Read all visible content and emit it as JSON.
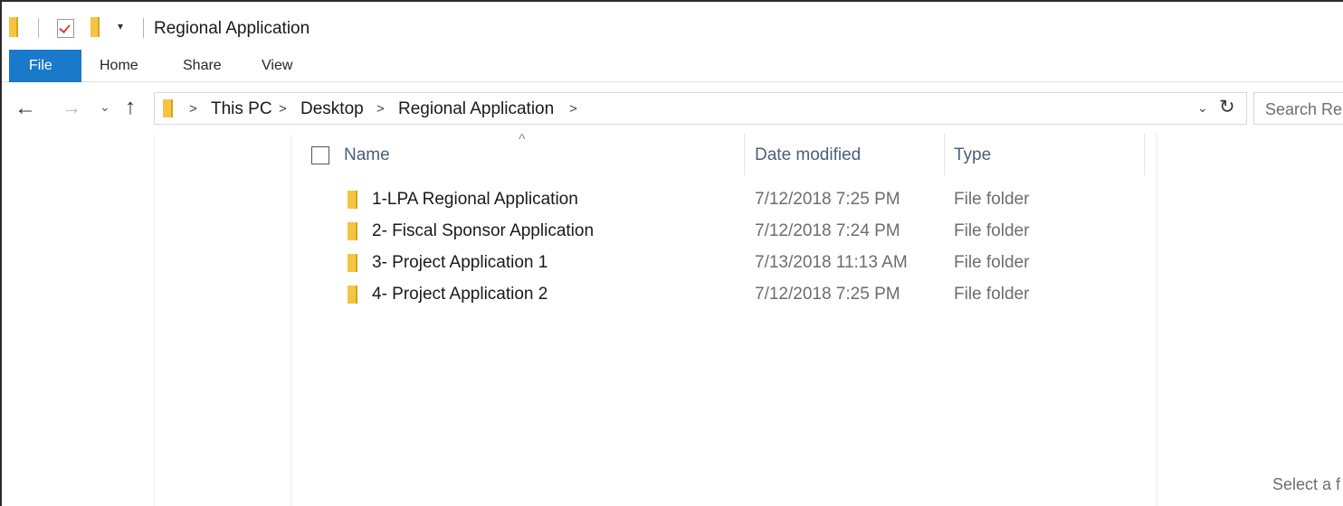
{
  "window": {
    "title": "Regional Application"
  },
  "quick_access": {
    "folder_icon": "folder-icon",
    "properties_icon": "properties-checkmark-icon",
    "new_folder_icon": "new-folder-icon",
    "customize_glyph": "▾"
  },
  "ribbon": {
    "tabs": [
      {
        "label": "File"
      },
      {
        "label": "Home"
      },
      {
        "label": "Share"
      },
      {
        "label": "View"
      }
    ]
  },
  "nav": {
    "back_glyph": "←",
    "forward_glyph": "→",
    "recent_glyph": "⌄",
    "up_glyph": "↑",
    "breadcrumbs": [
      "This PC",
      "Desktop",
      "Regional Application"
    ],
    "chevron": ">",
    "dropdown_glyph": "⌄",
    "refresh_glyph": "↻",
    "search_placeholder": "Search Re"
  },
  "columns": {
    "sort_glyph": "^",
    "name": "Name",
    "date_modified": "Date modified",
    "type": "Type"
  },
  "files": [
    {
      "name": "1-LPA Regional Application",
      "date": "7/12/2018 7:25 PM",
      "type": "File folder"
    },
    {
      "name": "2- Fiscal Sponsor Application",
      "date": "7/12/2018 7:24 PM",
      "type": "File folder"
    },
    {
      "name": "3- Project Application 1",
      "date": "7/13/2018 11:13 AM",
      "type": "File folder"
    },
    {
      "name": "4- Project Application 2",
      "date": "7/12/2018 7:25 PM",
      "type": "File folder"
    }
  ],
  "preview_pane": {
    "text": "Select a f"
  },
  "colors": {
    "file_tab": "#1979ca",
    "folder_yellow": "#f4c542",
    "header_text": "#4c607a",
    "secondary_text": "#6d6d6d"
  }
}
